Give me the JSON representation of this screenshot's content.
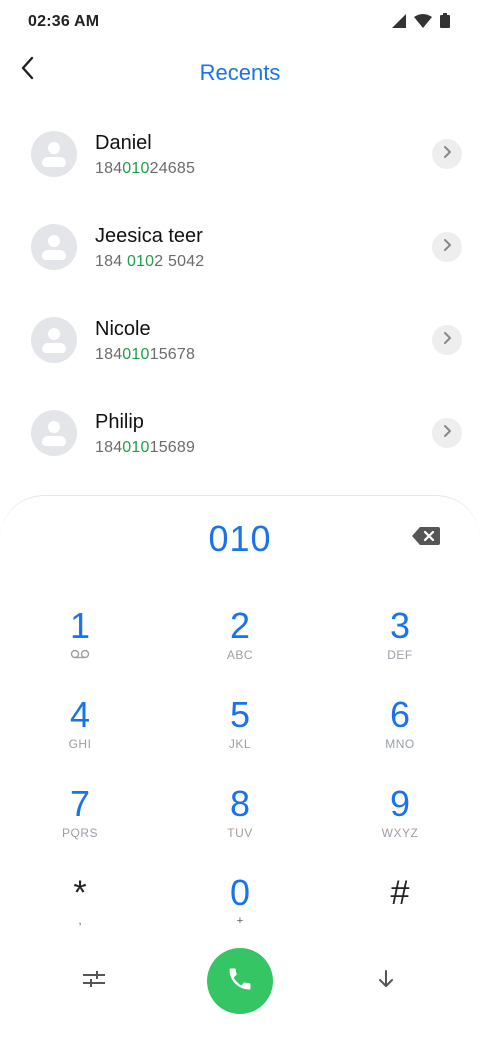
{
  "status_bar": {
    "time": "02:36 AM",
    "icons": [
      "signal-icon",
      "wifi-icon",
      "battery-icon"
    ]
  },
  "header": {
    "title": "Recents",
    "back_icon": "chevron-left-icon"
  },
  "contacts": [
    {
      "name": "Daniel",
      "number_parts": [
        "184",
        "010",
        "24685"
      ]
    },
    {
      "name": "Jeesica teer",
      "number_parts": [
        "184 ",
        "010",
        "2 5042"
      ]
    },
    {
      "name": "Nicole",
      "number_parts": [
        "184",
        "010",
        "15678"
      ]
    },
    {
      "name": "Philip",
      "number_parts": [
        "184",
        "010",
        "15689"
      ]
    }
  ],
  "dialpad": {
    "input_value": "010",
    "keys": [
      {
        "digit": "1",
        "letters": ""
      },
      {
        "digit": "2",
        "letters": "ABC"
      },
      {
        "digit": "3",
        "letters": "DEF"
      },
      {
        "digit": "4",
        "letters": "GHI"
      },
      {
        "digit": "5",
        "letters": "JKL"
      },
      {
        "digit": "6",
        "letters": "MNO"
      },
      {
        "digit": "7",
        "letters": "PQRS"
      },
      {
        "digit": "8",
        "letters": "TUV"
      },
      {
        "digit": "9",
        "letters": "WXYZ"
      },
      {
        "digit": "*",
        "letters": ","
      },
      {
        "digit": "0",
        "letters": "+"
      },
      {
        "digit": "#",
        "letters": ""
      }
    ]
  },
  "colors": {
    "accent": "#1a73e8",
    "match_highlight": "#1e9e4a",
    "call_button": "#36c565",
    "avatar_bg": "#e3e5e8"
  }
}
